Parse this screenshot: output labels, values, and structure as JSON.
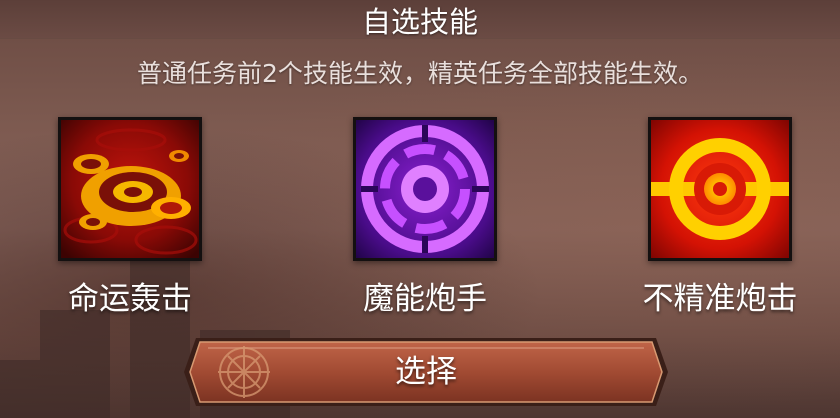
{
  "dialog": {
    "title": "自选技能",
    "description": "普通任务前2个技能生效，精英任务全部技能生效。"
  },
  "skills": [
    {
      "name": "命运轰击",
      "icon": "fate-bombard-icon",
      "accent": "#f5c000"
    },
    {
      "name": "魔能炮手",
      "icon": "arcane-gunner-icon",
      "accent": "#c040ff"
    },
    {
      "name": "不精准炮击",
      "icon": "inaccurate-shelling-icon",
      "accent": "#ffd800"
    }
  ],
  "select_button": {
    "label": "选择",
    "emblem_icon": "compass-emblem-icon"
  },
  "colors": {
    "button_fill": "#a24b33",
    "frame": "#141010",
    "text": "#ffffff"
  }
}
